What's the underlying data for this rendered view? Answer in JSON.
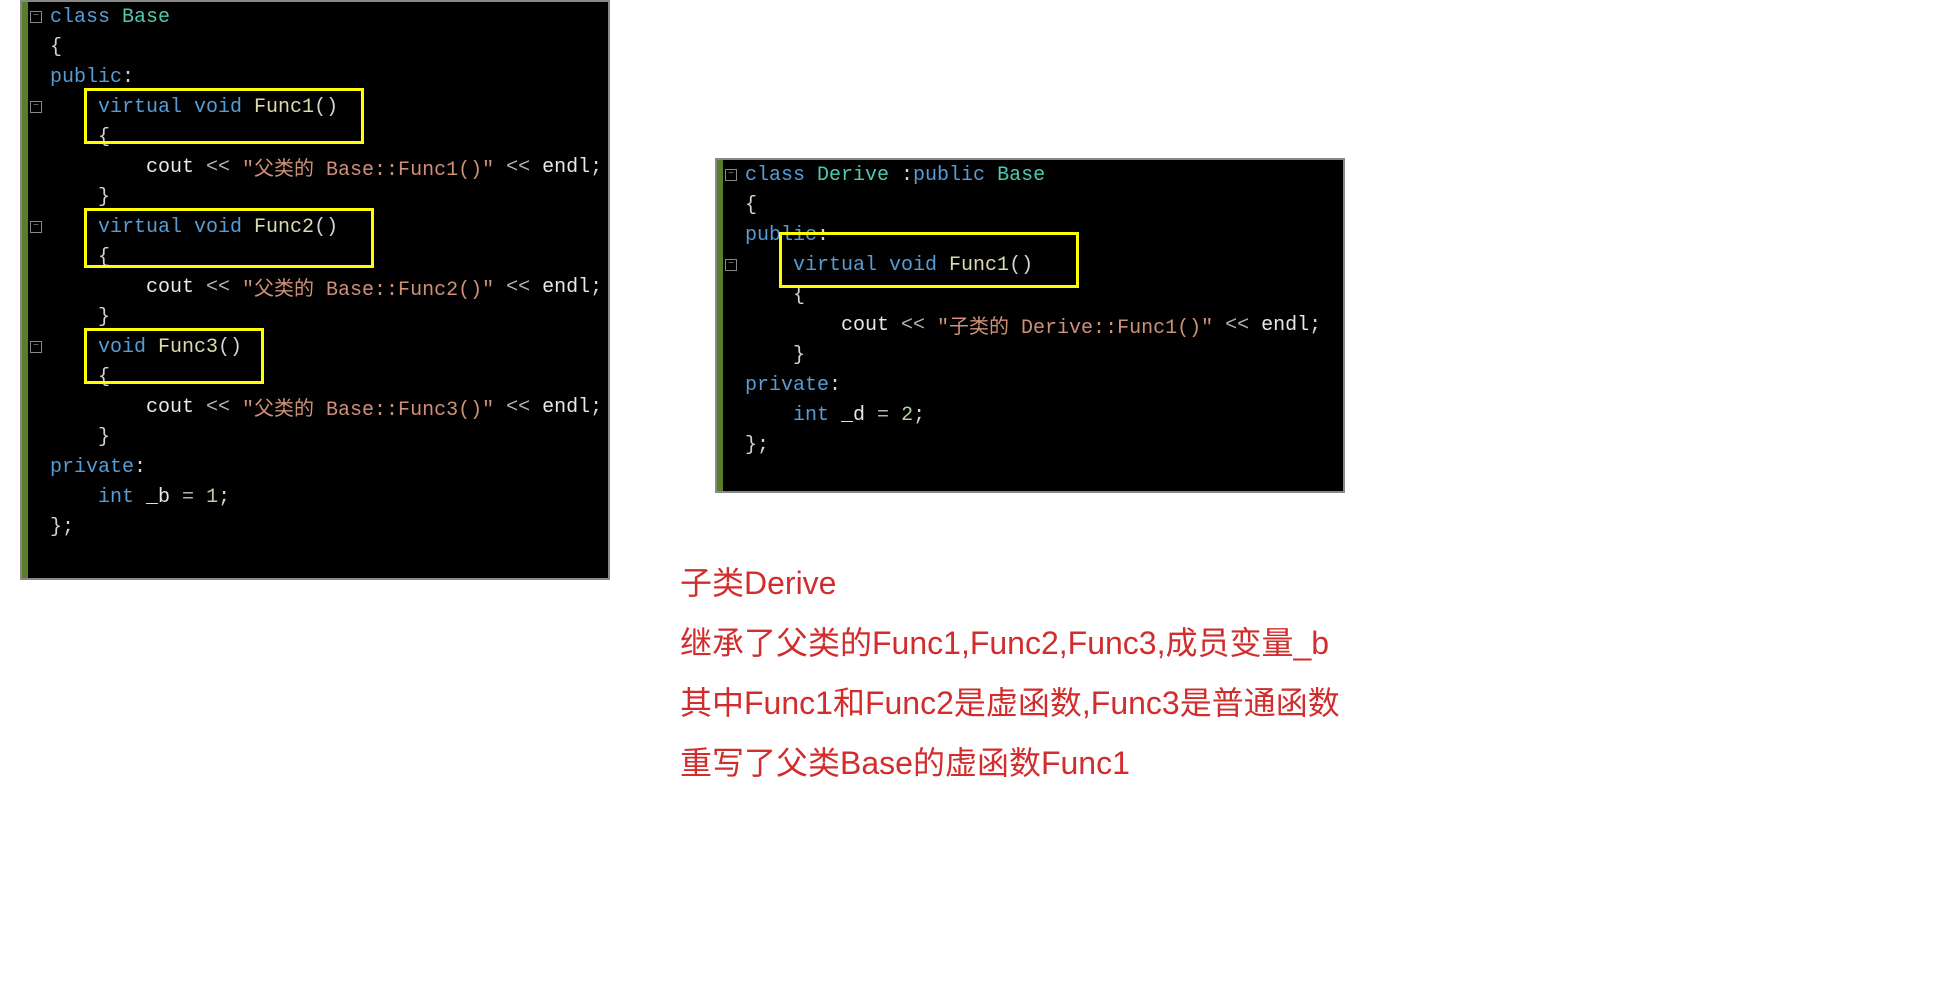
{
  "panel_left": {
    "l0": {
      "kw": "class ",
      "type": "Base"
    },
    "l1": {
      "brace": "{"
    },
    "l2": {
      "kw": "public",
      "colon": ":"
    },
    "l3": {
      "indent": "    ",
      "kw": "virtual void ",
      "func": "Func1",
      "paren": "()"
    },
    "l4": {
      "indent": "    ",
      "brace": "{"
    },
    "l5": {
      "indent": "        ",
      "cout": "cout ",
      "op1": "<< ",
      "str": "\"父类的 Base::Func1()\"",
      "op2": " << ",
      "endl": "endl",
      "semi": ";"
    },
    "l6": {
      "indent": "    ",
      "brace": "}"
    },
    "l7": {
      "indent": "    ",
      "kw": "virtual void ",
      "func": "Func2",
      "paren": "()"
    },
    "l8": {
      "indent": "    ",
      "brace": "{"
    },
    "l9": {
      "indent": "        ",
      "cout": "cout ",
      "op1": "<< ",
      "str": "\"父类的 Base::Func2()\"",
      "op2": " << ",
      "endl": "endl",
      "semi": ";"
    },
    "l10": {
      "indent": "    ",
      "brace": "}"
    },
    "l11": {
      "indent": "    ",
      "kw": "void ",
      "func": "Func3",
      "paren": "()"
    },
    "l12": {
      "indent": "    ",
      "brace": "{"
    },
    "l13": {
      "indent": "        ",
      "cout": "cout ",
      "op1": "<< ",
      "str": "\"父类的 Base::Func3()\"",
      "op2": " << ",
      "endl": "endl",
      "semi": ";"
    },
    "l14": {
      "indent": "    ",
      "brace": "}"
    },
    "l15": {
      "kw": "private",
      "colon": ":"
    },
    "l16": {
      "indent": "    ",
      "kw": "int ",
      "var": "_b ",
      "eq": "= ",
      "num": "1",
      "semi": ";"
    },
    "l17": {
      "brace": "};"
    }
  },
  "panel_right": {
    "l0": {
      "kw": "class ",
      "type": "Derive ",
      "colon": ":",
      "pub": "public ",
      "base": "Base"
    },
    "l1": {
      "brace": "{"
    },
    "l2": {
      "kw": "public",
      "colon": ":"
    },
    "l3": {
      "indent": "    ",
      "kw": "virtual void ",
      "func": "Func1",
      "paren": "()"
    },
    "l4": {
      "indent": "    ",
      "brace": "{"
    },
    "l5": {
      "indent": "        ",
      "cout": "cout ",
      "op1": "<< ",
      "str": "\"子类的 Derive::Func1()\"",
      "op2": " << ",
      "endl": "endl",
      "semi": ";"
    },
    "l6": {
      "indent": "    ",
      "brace": "}"
    },
    "l7": {
      "kw": "private",
      "colon": ":"
    },
    "l8": {
      "indent": "    ",
      "kw": "int ",
      "var": "_d ",
      "eq": "= ",
      "num": "2",
      "semi": ";"
    },
    "l9": {
      "brace": "};"
    }
  },
  "annotation": {
    "line1": "子类Derive",
    "line2": "继承了父类的Func1,Func2,Func3,成员变量_b",
    "line3": "其中Func1和Func2是虚函数,Func3是普通函数",
    "line4": "重写了父类Base的虚函数Func1"
  }
}
